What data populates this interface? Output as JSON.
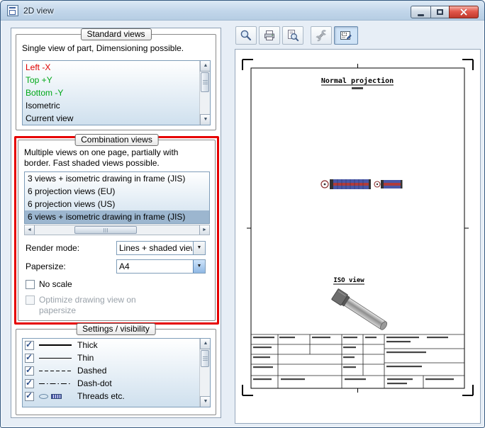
{
  "titlebar": {
    "title": "2D view",
    "buttons": [
      {
        "name": "minimize"
      },
      {
        "name": "maximize"
      },
      {
        "name": "close"
      }
    ]
  },
  "left_panel": {
    "standard_views": {
      "label": "Standard views",
      "description": "Single view of part, Dimensioning possible.",
      "items": [
        {
          "label": "Left -X",
          "color": "#e00000"
        },
        {
          "label": "Top +Y",
          "color": "#00a818"
        },
        {
          "label": "Bottom -Y",
          "color": "#00a818"
        },
        {
          "label": "Isometric",
          "color": "#000000"
        },
        {
          "label": "Current view",
          "color": "#000000"
        }
      ]
    },
    "combination_views": {
      "label": "Combination views",
      "description": "Multiple views on one page, partially with border. Fast shaded views possible.",
      "items": [
        {
          "label": "3 views + isometric drawing in frame (JIS)",
          "selected": false
        },
        {
          "label": "6 projection views (EU)",
          "selected": false
        },
        {
          "label": "6 projection views (US)",
          "selected": false
        },
        {
          "label": "6 views + isometric drawing in frame (JIS)",
          "selected": true
        }
      ],
      "render_mode": {
        "label": "Render mode:",
        "value": "Lines + shaded view"
      },
      "papersize": {
        "label": "Papersize:",
        "value": "A4"
      },
      "no_scale": {
        "label": "No scale",
        "checked": false
      },
      "optimize": {
        "label": "Optimize drawing view on papersize",
        "checked": false,
        "enabled": false
      }
    },
    "settings": {
      "label": "Settings / visibility",
      "items": [
        {
          "label": "Thick",
          "checked": true,
          "sample": "thick-line"
        },
        {
          "label": "Thin",
          "checked": true,
          "sample": "thin-line"
        },
        {
          "label": "Dashed",
          "checked": true,
          "sample": "dashed-line"
        },
        {
          "label": "Dash-dot",
          "checked": true,
          "sample": "dashdot-line"
        },
        {
          "label": "Threads etc.",
          "checked": true,
          "sample": "threads-icons"
        }
      ]
    }
  },
  "toolbar": {
    "buttons": [
      {
        "name": "zoom",
        "icon": "magnifier-icon",
        "pressed": false
      },
      {
        "name": "print",
        "icon": "printer-icon",
        "pressed": false
      },
      {
        "name": "print-preview",
        "icon": "preview-magnifier-icon",
        "pressed": false
      },
      {
        "name": "tools",
        "icon": "wrench-icon",
        "pressed": false
      },
      {
        "name": "drawing-view",
        "icon": "drawing-view-icon",
        "pressed": true
      }
    ]
  },
  "drawing": {
    "normal_projection_label": "Normal projection",
    "iso_view_label": "ISO view"
  }
}
